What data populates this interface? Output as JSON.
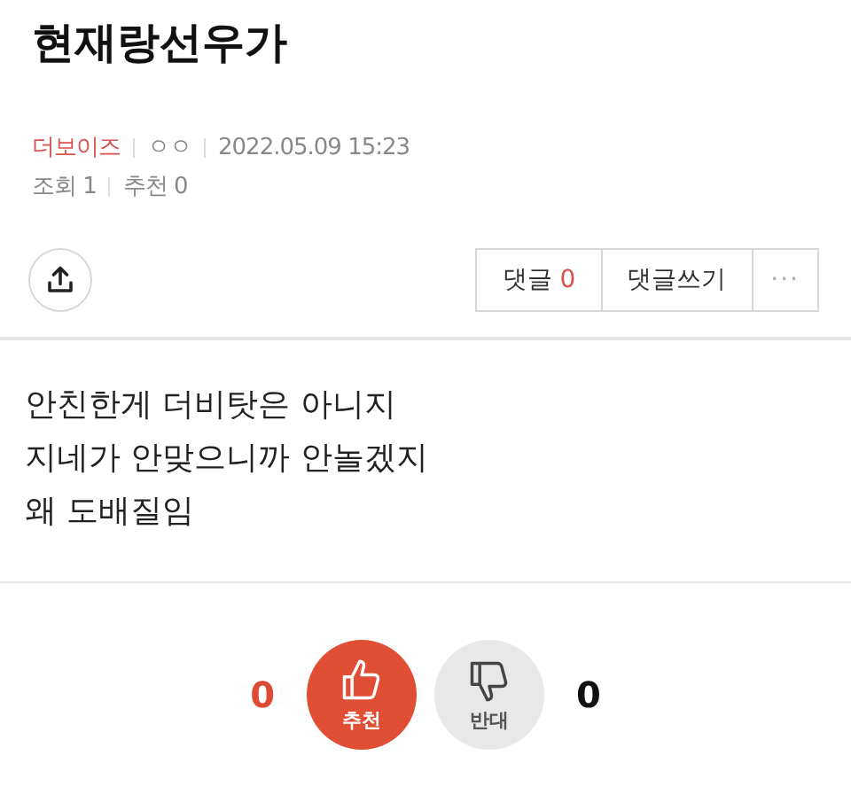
{
  "title": "현재랑선우가",
  "meta": {
    "author": "더보이즈",
    "nickname": "ㅇㅇ",
    "date": "2022.05.09 15:23",
    "views": "조회 1",
    "recommends": "추천 0"
  },
  "actions": {
    "comments_label": "댓글",
    "comments_count": "0",
    "write_comment": "댓글쓰기",
    "more": "···"
  },
  "body": [
    "안친한게 더비탓은 아니지",
    "지네가 안맞으니까 안놀겠지",
    "왜 도배질임"
  ],
  "votes": [
    {
      "kind": "up",
      "count": "0",
      "label": "추천"
    },
    {
      "kind": "down",
      "label": "반대",
      "count": "0"
    }
  ]
}
